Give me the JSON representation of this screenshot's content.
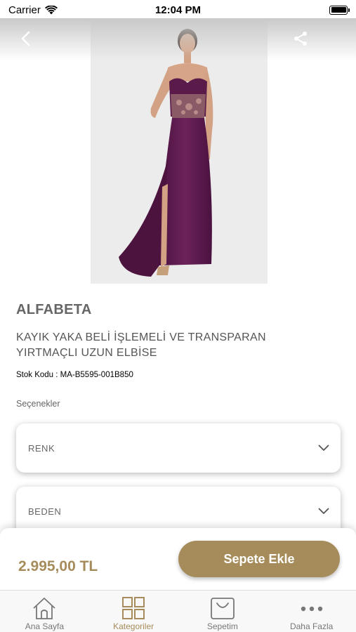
{
  "status_bar": {
    "carrier": "Carrier",
    "time": "12:04 PM"
  },
  "product": {
    "brand": "ALFABETA",
    "title": "KAYIK YAKA BELİ İŞLEMELİ VE TRANSPARAN YIRTMAÇLI UZUN ELBİSE",
    "stock_code": "Stok Kodu : MA-B5595-001B850",
    "image_icon": "dress-photo"
  },
  "options": {
    "label": "Seçenekler",
    "selects": [
      {
        "label": "RENK"
      },
      {
        "label": "BEDEN"
      }
    ]
  },
  "cart": {
    "price": "2.995,00 TL",
    "add_button": "Sepete Ekle"
  },
  "tabs": [
    {
      "label": "Ana Sayfa",
      "icon": "home-icon",
      "active": false
    },
    {
      "label": "Kategoriler",
      "icon": "grid-icon",
      "active": true
    },
    {
      "label": "Sepetim",
      "icon": "shopping-bag-icon",
      "active": false
    },
    {
      "label": "Daha Fazla",
      "icon": "more-icon",
      "active": false
    }
  ],
  "colors": {
    "accent": "#a68c5b",
    "dress": "#5e1b4d"
  }
}
